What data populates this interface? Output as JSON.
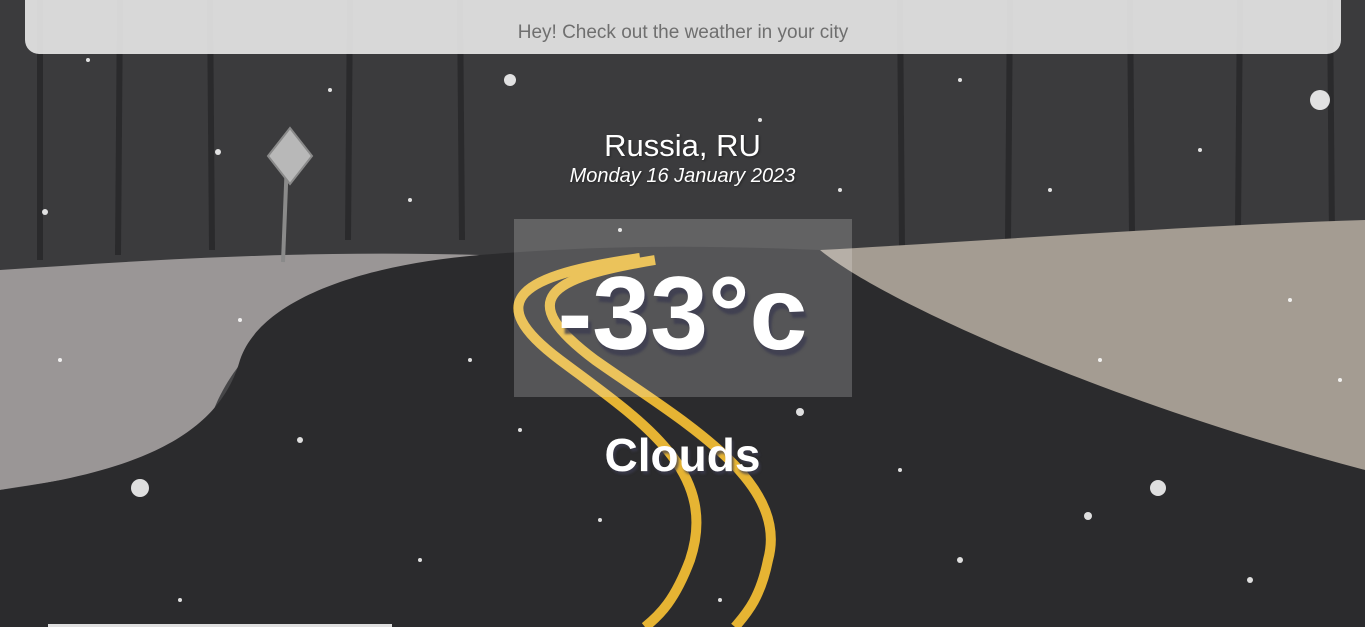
{
  "search": {
    "placeholder": "Hey! Check out the weather in your city"
  },
  "weather": {
    "location": "Russia, RU",
    "date": "Monday 16 January 2023",
    "temperature": "-33°c",
    "condition": "Clouds"
  },
  "background": {
    "icon": "snowy-road-scene",
    "road_color": "#2b2b2d",
    "line_color": "#e6b433",
    "snow_color": "#ffffff"
  }
}
